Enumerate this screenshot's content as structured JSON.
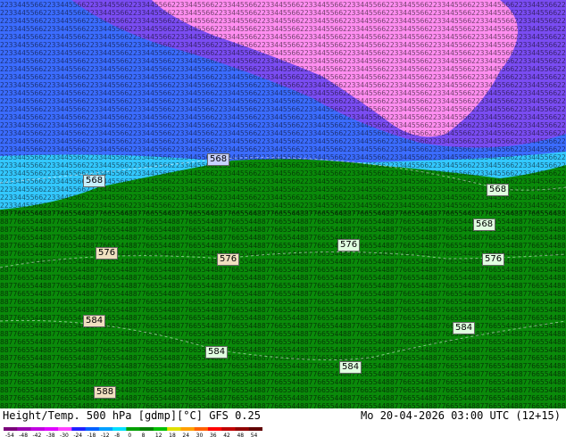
{
  "map": {
    "contour_labels": [
      "568",
      "568",
      "568",
      "568",
      "576",
      "576",
      "576",
      "576",
      "584",
      "584",
      "584",
      "584",
      "588"
    ]
  },
  "footer": {
    "title": "Height/Temp. 500 hPa [gdmp][°C] GFS 0.25",
    "run": "Mo 20-04-2026 03:00 UTC (12+15)"
  },
  "colorbar": {
    "tick_labels": [
      "-54",
      "-48",
      "-42",
      "-38",
      "-30",
      "-24",
      "-18",
      "-12",
      "-8",
      "0",
      "8",
      "12",
      "18",
      "24",
      "30",
      "36",
      "42",
      "48",
      "54"
    ],
    "colors": [
      "#7a007a",
      "#9a00b0",
      "#c000e0",
      "#e000ff",
      "#ff40ff",
      "#2020ff",
      "#0060ff",
      "#00a0ff",
      "#00e0ff",
      "#00a000",
      "#008000",
      "#00c000",
      "#e0e000",
      "#ffa000",
      "#ff6000",
      "#ff0000",
      "#c00000",
      "#900000",
      "#600000"
    ]
  },
  "colors": {
    "magenta_fill": "#ff88ee",
    "purple_fill": "#8844ff",
    "blue_fill": "#3366ff",
    "cyan_fill": "#33ccff",
    "green_fill": "#0a8a0a"
  }
}
